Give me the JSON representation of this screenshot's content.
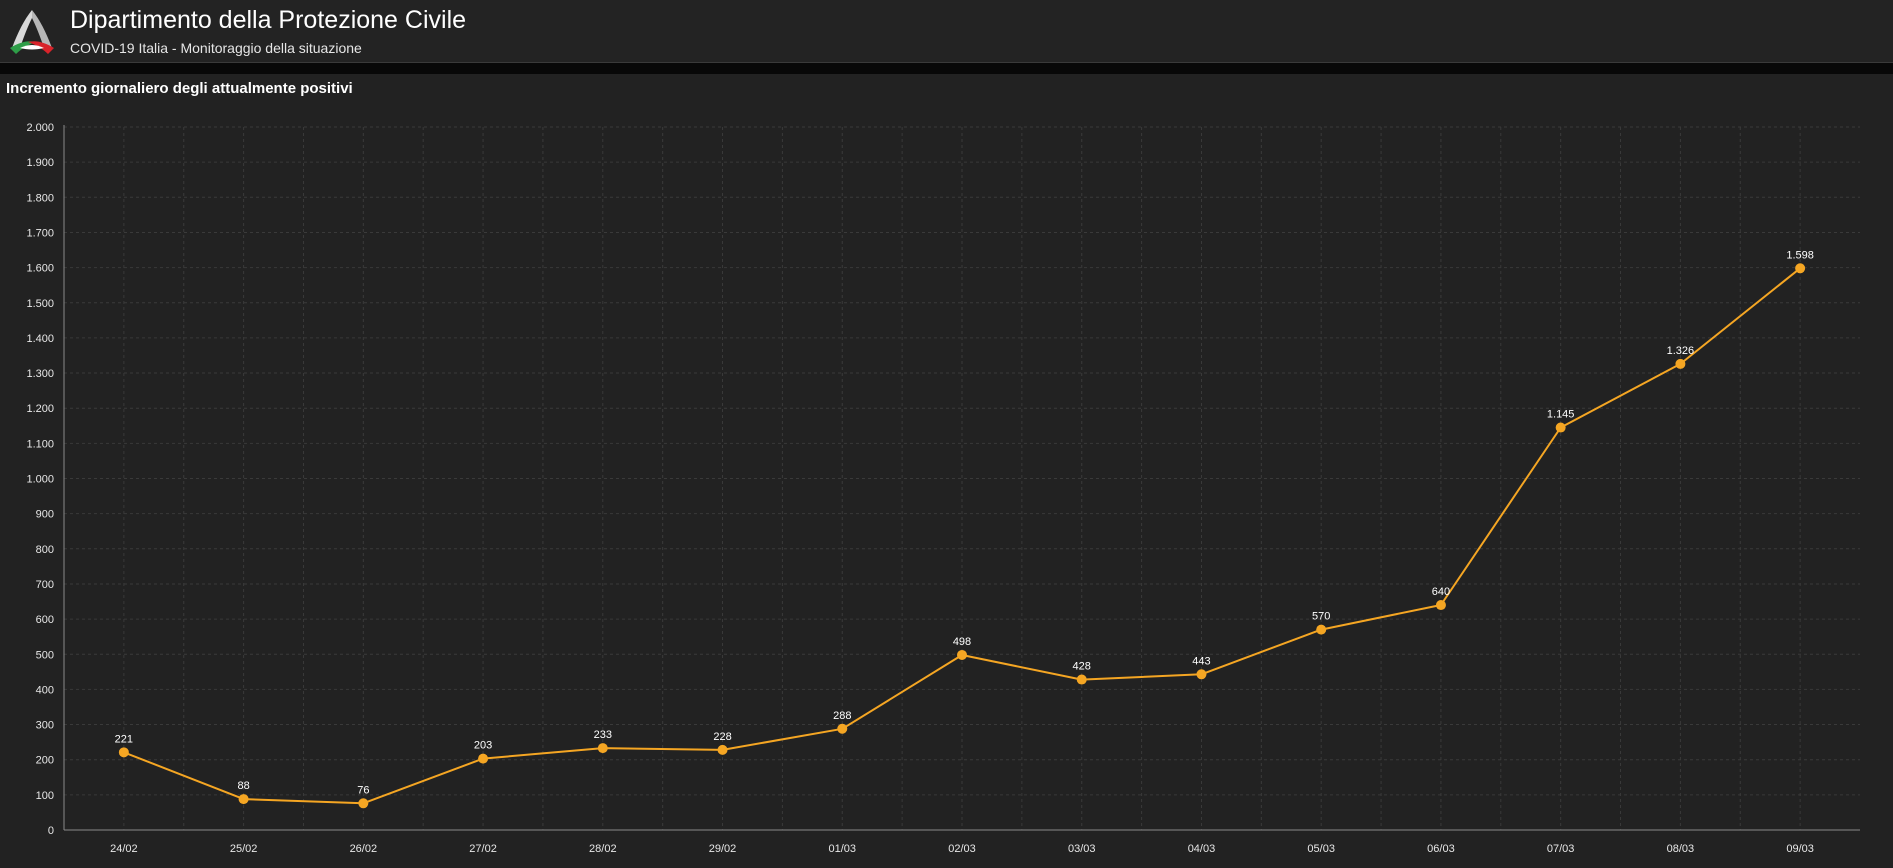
{
  "header": {
    "title": "Dipartimento della Protezione Civile",
    "subtitle": "COVID-19 Italia - Monitoraggio della situazione"
  },
  "panel": {
    "title": "Incremento giornaliero degli attualmente positivi"
  },
  "colors": {
    "line": "#f5a623",
    "grid": "#3a3a3a",
    "axis": "#8a8a8a"
  },
  "chart_data": {
    "type": "line",
    "title": "Incremento giornaliero degli attualmente positivi",
    "categories": [
      "24/02",
      "25/02",
      "26/02",
      "27/02",
      "28/02",
      "29/02",
      "01/03",
      "02/03",
      "03/03",
      "04/03",
      "05/03",
      "06/03",
      "07/03",
      "08/03",
      "09/03"
    ],
    "series": [
      {
        "values": [
          221,
          88,
          76,
          203,
          233,
          228,
          288,
          498,
          428,
          443,
          570,
          640,
          1145,
          1326,
          1598
        ],
        "labels": [
          "221",
          "88",
          "76",
          "203",
          "233",
          "228",
          "288",
          "498",
          "428",
          "443",
          "570",
          "640",
          "1.145",
          "1.326",
          "1.598"
        ]
      }
    ],
    "ylim": [
      0,
      2000
    ],
    "yticks": [
      0,
      100,
      200,
      300,
      400,
      500,
      600,
      700,
      800,
      900,
      1000,
      1100,
      1200,
      1300,
      1400,
      1500,
      1600,
      1700,
      1800,
      1900,
      2000
    ],
    "ytick_labels": [
      "0",
      "100",
      "200",
      "300",
      "400",
      "500",
      "600",
      "700",
      "800",
      "900",
      "1.000",
      "1.100",
      "1.200",
      "1.300",
      "1.400",
      "1.500",
      "1.600",
      "1.700",
      "1.800",
      "1.900",
      "2.000"
    ],
    "grid": true,
    "legend": "none"
  }
}
